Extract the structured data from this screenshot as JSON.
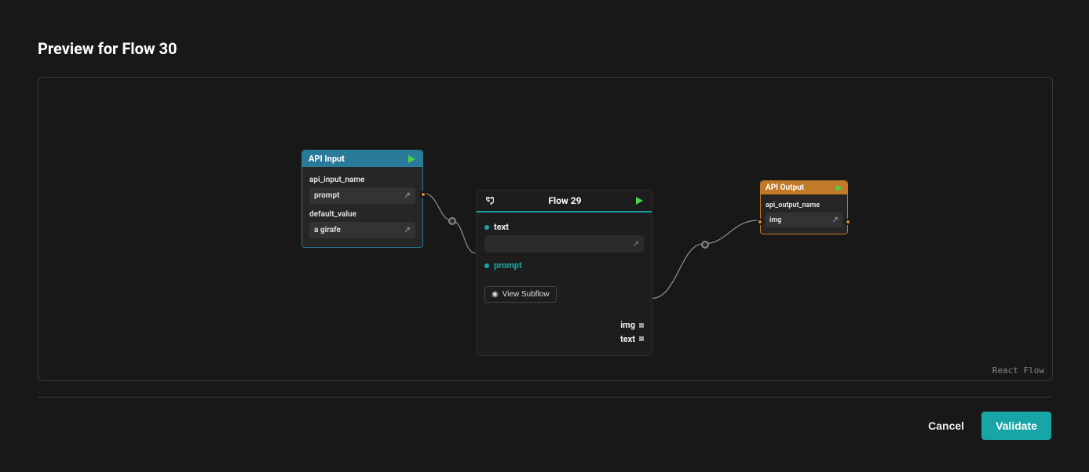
{
  "page_title": "Preview for Flow 30",
  "canvas": {
    "attribution": "React Flow",
    "nodes": {
      "api_input": {
        "title": "API Input",
        "fields": {
          "api_input_name": {
            "label": "api_input_name",
            "value": "prompt"
          },
          "default_value": {
            "label": "default_value",
            "value": "a girafe"
          }
        }
      },
      "flow29": {
        "title": "Flow 29",
        "inputs": {
          "text": {
            "label": "text",
            "value": ""
          },
          "prompt": {
            "label": "prompt"
          }
        },
        "view_subflow_label": "View Subflow",
        "outputs": {
          "img": "img",
          "text": "text"
        }
      },
      "api_output": {
        "title": "API Output",
        "fields": {
          "api_output_name": {
            "label": "api_output_name",
            "value": "img"
          }
        }
      }
    }
  },
  "footer": {
    "cancel_label": "Cancel",
    "validate_label": "Validate"
  }
}
